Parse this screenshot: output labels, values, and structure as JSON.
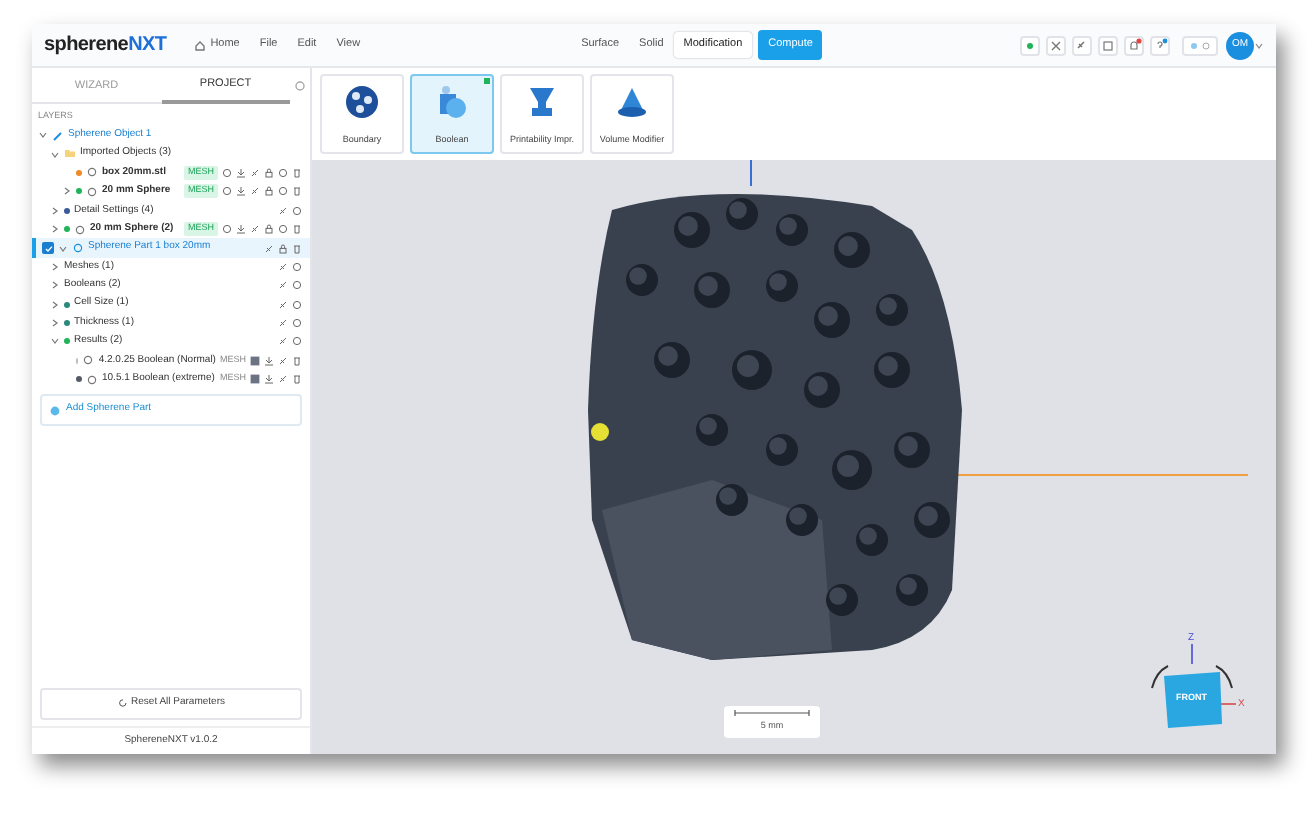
{
  "topbar": {
    "logo": {
      "text": "spherene",
      "accent": "NXT"
    },
    "menu": [
      {
        "label": "Home",
        "kind": "home"
      },
      {
        "label": "File",
        "kind": "plain"
      },
      {
        "label": "Edit",
        "kind": "plain"
      },
      {
        "label": "View",
        "kind": "plain"
      }
    ],
    "mode_tabs": [
      {
        "label": "Surface",
        "selected": false
      },
      {
        "label": "Solid",
        "selected": false
      },
      {
        "label": "Modification",
        "selected": true
      }
    ],
    "action_button": "Compute",
    "avatar": "OM"
  },
  "panel": {
    "tabs": [
      {
        "label": "WIZARD",
        "selected": false
      },
      {
        "label": "PROJECT",
        "selected": true
      }
    ],
    "section_label": "LAYERS",
    "tree": [
      {
        "kind": "object",
        "label": "Spherene Object 1",
        "expanded": true,
        "children": [
          {
            "kind": "folder",
            "label": "Imported Objects (3)",
            "expanded": true,
            "children": [
              {
                "kind": "mesh",
                "label": "box 20mm.stl",
                "color": "#f08a24",
                "badge": "MESH"
              },
              {
                "kind": "mesh",
                "label": "20 mm Sphere",
                "expanded": false,
                "color": "#1fb45a",
                "badge": "MESH"
              }
            ]
          },
          {
            "kind": "group",
            "label": "Detail Settings (4)",
            "expanded": false,
            "color": "#3c5a9a"
          },
          {
            "kind": "mesh",
            "label": "20 mm Sphere (2)",
            "expanded": false,
            "color": "#1fb45a",
            "badge": "MESH"
          }
        ]
      },
      {
        "kind": "part",
        "label": "Spherene Part 1 box 20mm",
        "expanded": true,
        "checked": true,
        "selected": true,
        "children": [
          {
            "kind": "group",
            "label": "Meshes (1)",
            "expanded": false
          },
          {
            "kind": "group",
            "label": "Booleans (2)",
            "expanded": false
          },
          {
            "kind": "group",
            "label": "Cell Size (1)",
            "expanded": false,
            "color": "#2a8a7a"
          },
          {
            "kind": "group",
            "label": "Thickness (1)",
            "expanded": false,
            "color": "#2a8a7a"
          },
          {
            "kind": "group",
            "label": "Results (2)",
            "expanded": true,
            "color": "#1fb45a",
            "children": [
              {
                "kind": "result",
                "label": "4.2.0.25 Boolean (Normal)",
                "color": "#b8bcc4",
                "badge": "MESH"
              },
              {
                "kind": "result",
                "label": "10.5.1 Boolean (extreme)",
                "color": "#555b66",
                "badge": "MESH"
              }
            ]
          }
        ]
      }
    ],
    "add_button": "Add Spherene Part",
    "reset_button": "Reset All Parameters",
    "version": "SphereneNXT v1.0.2"
  },
  "tools": [
    {
      "label": "Boundary",
      "kind": "boundary",
      "selected": false
    },
    {
      "label": "Boolean",
      "kind": "boolean",
      "selected": true
    },
    {
      "label": "Printability Impr.",
      "kind": "printability",
      "selected": false
    },
    {
      "label": "Volume Modifier",
      "kind": "volume",
      "selected": false
    }
  ],
  "viewport": {
    "scale_bar": "5 mm",
    "nav_cube": {
      "face": "FRONT",
      "z": "Z",
      "x": "X"
    }
  }
}
